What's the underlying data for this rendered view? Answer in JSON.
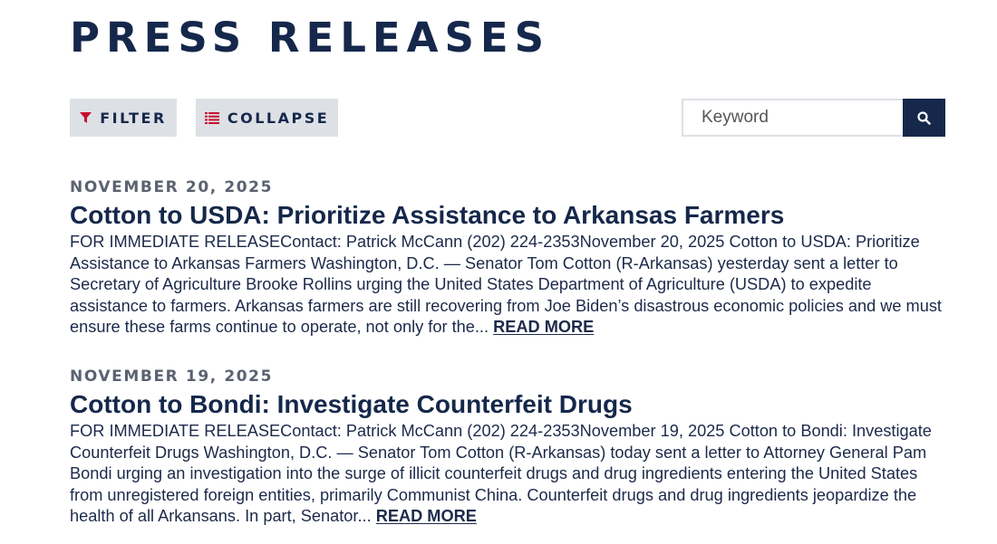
{
  "page": {
    "title": "PRESS RELEASES"
  },
  "toolbar": {
    "filter_label": "FILTER",
    "collapse_label": "COLLAPSE",
    "filter_icon": "filter-icon",
    "collapse_icon": "list-icon"
  },
  "search": {
    "placeholder": "Keyword",
    "value": "",
    "button_icon": "search-icon"
  },
  "releases": [
    {
      "date": "NOVEMBER 20, 2025",
      "title": "Cotton to USDA: Prioritize Assistance to Arkansas Farmers",
      "excerpt": "FOR IMMEDIATE RELEASEContact: Patrick McCann (202) 224-2353November 20, 2025 Cotton to USDA: Prioritize Assistance to Arkansas Farmers Washington, D.C. — Senator Tom Cotton (R-Arkansas) yesterday sent a letter to Secretary of Agriculture Brooke Rollins urging the United States Department of Agriculture (USDA) to expedite assistance to farmers. Arkansas farmers are still recovering from Joe Biden’s disastrous economic policies and we must ensure these farms continue to operate, not only for the...",
      "read_more": "READ MORE"
    },
    {
      "date": "NOVEMBER 19, 2025",
      "title": "Cotton to Bondi: Investigate Counterfeit Drugs",
      "excerpt": "FOR IMMEDIATE RELEASEContact: Patrick McCann (202) 224-2353November 19, 2025 Cotton to Bondi: Investigate Counterfeit Drugs Washington, D.C. — Senator Tom Cotton (R-Arkansas) today sent a letter to Attorney General Pam Bondi urging an investigation into the surge of illicit counterfeit drugs and drug ingredients entering the United States from unregistered foreign entities, primarily Communist China. Counterfeit drugs and drug ingredients jeopardize the health of all Arkansans. In part, Senator...",
      "read_more": "READ MORE"
    }
  ],
  "colors": {
    "navy": "#15284b",
    "button_bg": "#dde0e5",
    "filter_icon": "#c8102e",
    "collapse_icon": "#c8102e",
    "date_gray": "#5b6270"
  }
}
